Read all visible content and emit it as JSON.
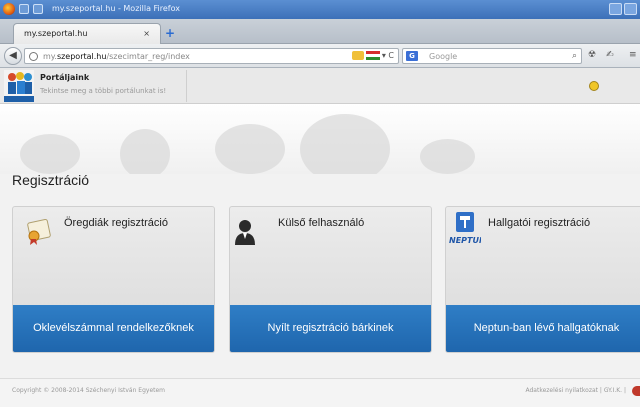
{
  "window": {
    "title": "my.szeportal.hu - Mozilla Firefox"
  },
  "tab": {
    "label": "my.szeportal.hu",
    "close": "×"
  },
  "nav": {
    "url_prefix": "my.",
    "url_domain": "szeportal.hu",
    "url_path": "/szecimtar_reg/index",
    "search_placeholder": "Google",
    "url_reload": "▾ C"
  },
  "portal": {
    "title": "Portáljaink",
    "subtitle": "Tekintse meg a többi portálunkat is!"
  },
  "page": {
    "title": "Regisztráció"
  },
  "cards": [
    {
      "title": "Öregdiák regisztráció",
      "button": "Oklevélszámmal rendelkezőknek",
      "icon": "diploma-icon"
    },
    {
      "title": "Külső felhasználó",
      "button": "Nyílt regisztráció bárkinek",
      "icon": "user-icon"
    },
    {
      "title": "Hallgatói regisztráció",
      "button": "Neptun-ban lévő hallgatóknak",
      "icon": "neptun-icon",
      "icon_text": "NEPTUN"
    }
  ],
  "footer": {
    "copyright": "Copyright © 2008-2014 Széchenyi István Egyetem",
    "links": "Adatkezelési nyilatkozat  |  GY.I.K.  |"
  },
  "colors": {
    "accent": "#2a74bf",
    "titlebar": "#4a7fc4"
  }
}
